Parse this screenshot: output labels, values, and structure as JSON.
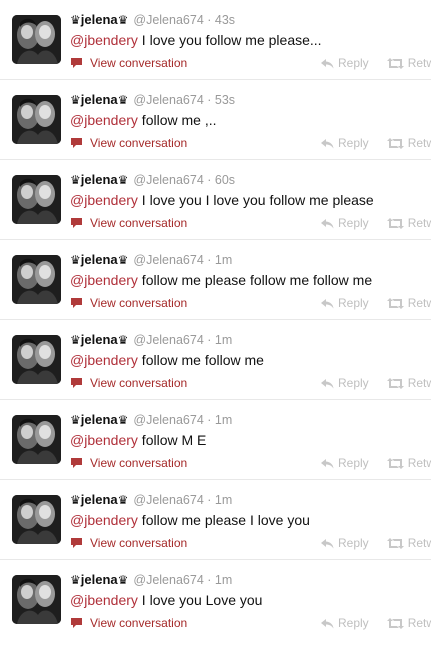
{
  "colors": {
    "mention": "#b0303a",
    "view_conversation": "#a52a2a",
    "meta": "#999999",
    "actions": "#bfbfbf"
  },
  "icons": {
    "crown": "crown-icon",
    "conversation": "speech-bubble-icon",
    "reply": "reply-arrow-icon",
    "retweet": "retweet-icon"
  },
  "tweets": [
    {
      "crown_left": "♛",
      "name": "jelena",
      "crown_right": "♛",
      "username": "@Jelena674",
      "sep": " · ",
      "time": "43s",
      "mention": "@jbendery",
      "text": " I love you follow me please...",
      "view_conversation": "View conversation",
      "reply": "Reply",
      "retweet": "Retwe"
    },
    {
      "crown_left": "♛",
      "name": "jelena",
      "crown_right": "♛",
      "username": "@Jelena674",
      "sep": " · ",
      "time": "53s",
      "mention": "@jbendery",
      "text": " follow me ,..",
      "view_conversation": "View conversation",
      "reply": "Reply",
      "retweet": "Retwe"
    },
    {
      "crown_left": "♛",
      "name": "jelena",
      "crown_right": "♛",
      "username": "@Jelena674",
      "sep": " · ",
      "time": "60s",
      "mention": "@jbendery",
      "text": " I love you I love you follow me please",
      "view_conversation": "View conversation",
      "reply": "Reply",
      "retweet": "Retwe"
    },
    {
      "crown_left": "♛",
      "name": "jelena",
      "crown_right": "♛",
      "username": "@Jelena674",
      "sep": " · ",
      "time": "1m",
      "mention": "@jbendery",
      "text": " follow me please follow me follow me",
      "view_conversation": "View conversation",
      "reply": "Reply",
      "retweet": "Retwe"
    },
    {
      "crown_left": "♛",
      "name": "jelena",
      "crown_right": "♛",
      "username": "@Jelena674",
      "sep": " · ",
      "time": "1m",
      "mention": "@jbendery",
      "text": " follow me follow me",
      "view_conversation": "View conversation",
      "reply": "Reply",
      "retweet": "Retwe"
    },
    {
      "crown_left": "♛",
      "name": "jelena",
      "crown_right": "♛",
      "username": "@Jelena674",
      "sep": " · ",
      "time": "1m",
      "mention": "@jbendery",
      "text": " follow M E",
      "view_conversation": "View conversation",
      "reply": "Reply",
      "retweet": "Retwe"
    },
    {
      "crown_left": "♛",
      "name": "jelena",
      "crown_right": "♛",
      "username": "@Jelena674",
      "sep": " · ",
      "time": "1m",
      "mention": "@jbendery",
      "text": " follow me please I love you",
      "view_conversation": "View conversation",
      "reply": "Reply",
      "retweet": "Retwe"
    },
    {
      "crown_left": "♛",
      "name": "jelena",
      "crown_right": "♛",
      "username": "@Jelena674",
      "sep": " · ",
      "time": "1m",
      "mention": "@jbendery",
      "text": " I love you Love you",
      "view_conversation": "View conversation",
      "reply": "Reply",
      "retweet": "Retwe"
    }
  ]
}
